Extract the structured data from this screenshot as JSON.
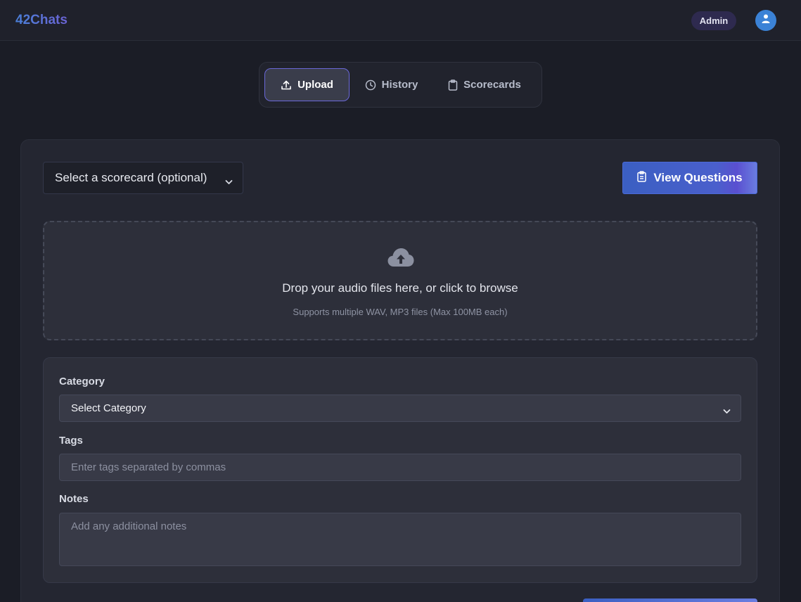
{
  "header": {
    "brand": "42Chats",
    "role_badge": "Admin",
    "avatar_icon": "user-icon"
  },
  "tabs": [
    {
      "label": "Upload",
      "icon": "upload-icon",
      "active": true
    },
    {
      "label": "History",
      "icon": "clock-icon",
      "active": false
    },
    {
      "label": "Scorecards",
      "icon": "clipboard-icon",
      "active": false
    }
  ],
  "toolbar": {
    "scorecard_select": "Select a scorecard (optional)",
    "view_questions_label": "View Questions"
  },
  "dropzone": {
    "icon": "cloud-upload-icon",
    "title": "Drop your audio files here, or click to browse",
    "subtitle": "Supports multiple WAV, MP3 files (Max 100MB each)"
  },
  "form": {
    "category_label": "Category",
    "category_value": "Select Category",
    "tags_label": "Tags",
    "tags_placeholder": "Enter tags separated by commas",
    "notes_label": "Notes",
    "notes_placeholder": "Add any additional notes"
  },
  "colors": {
    "background": "#1b1d26",
    "accent": "#3b5fc2",
    "active_tab_border": "#6a68d8",
    "avatar": "#3b82d6"
  }
}
